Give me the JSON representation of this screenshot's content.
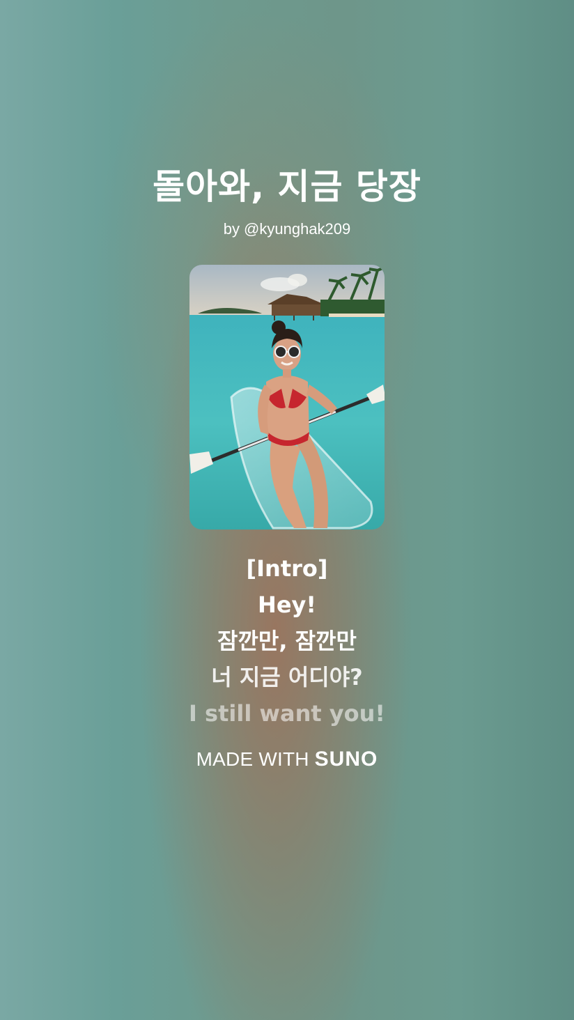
{
  "song": {
    "title": "돌아와, 지금 당장",
    "artist": "by @kyunghak209"
  },
  "cover_art": {
    "icon": "cover-art-image"
  },
  "lyrics": [
    "[Intro]",
    "Hey!",
    "잠깐만, 잠깐만",
    "너 지금 어디야?",
    "I still want you!"
  ],
  "footer": {
    "made_with": "MADE WITH",
    "brand": "SUNO"
  },
  "colors": {
    "background_teal": "#6e9a8e",
    "background_warm": "#a07058",
    "text": "#ffffff"
  }
}
